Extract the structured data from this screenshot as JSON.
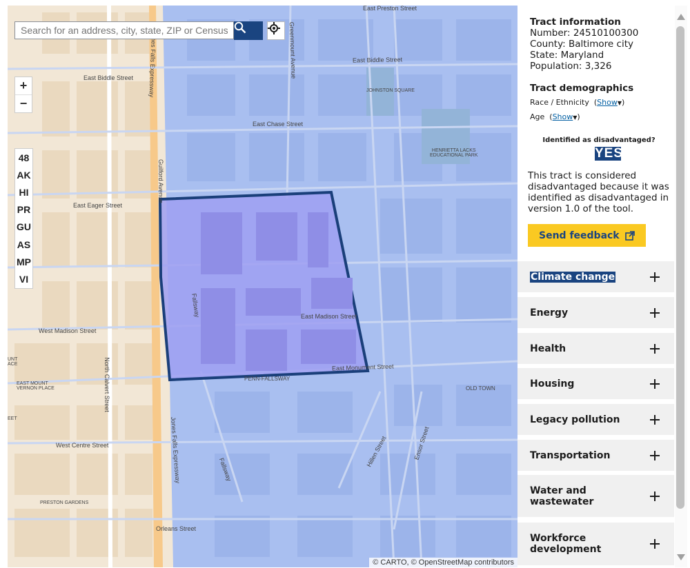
{
  "search": {
    "placeholder": "Search for an address, city, state, ZIP or Census Tract"
  },
  "zoom": {
    "in_label": "+",
    "out_label": "−"
  },
  "territories": [
    "48",
    "AK",
    "HI",
    "PR",
    "GU",
    "AS",
    "MP",
    "VI"
  ],
  "map": {
    "labels": {
      "east_preston": "East Preston Street",
      "east_biddle_top": "East Biddle Street",
      "east_biddle": "East Biddle Street",
      "east_chase": "East Chase Street",
      "east_eager": "East Eager Street",
      "east_madison": "East Madison Street",
      "east_monument": "East Monument Street",
      "west_madison": "West Madison Street",
      "west_centre": "West Centre Street",
      "orleans": "Orleans Street",
      "hillen": "Hillen Street",
      "ensor": "Ensor Street",
      "fallsway": "Fallsway",
      "fallsway2": "Fallsway",
      "guilford": "Guilford Avenue",
      "greenmount": "Greenmount Avenue",
      "n_calvert": "North Calvert Street",
      "jfe_top": "Jones Falls Expressway",
      "jfe_bottom": "Jones Falls Expressway",
      "johnston": "JOHNSTON SQUARE",
      "henrietta": "HENRIETTA LACKS\nEDUCATIONAL PARK",
      "penn_fallsway": "PENN-FALLSWAY",
      "old_town": "OLD TOWN",
      "east_mount_vernon": "EAST MOUNT\nVERNON PLACE",
      "preston_gardens": "PRESTON GARDENS",
      "mount_vernon": "UNT\nACE",
      "tail_street": "EET"
    },
    "attribution": "© CARTO, © OpenStreetMap contributors"
  },
  "panel": {
    "tract_info_heading": "Tract information",
    "number": "Number: 24510100300",
    "county": "County: Baltimore city",
    "state": "State: Maryland",
    "population": "Population: 3,326",
    "demographics_heading": "Tract demographics",
    "race_label": "Race / Ethnicity",
    "age_label": "Age",
    "show_label": "Show",
    "identified_label": "Identified as disadvantaged?",
    "identified_value": "YES",
    "reason": "This tract is considered disadvantaged because it was identified as disadvantaged in version 1.0 of the tool.",
    "feedback_label": "Send feedback",
    "categories": [
      "Climate change",
      "Energy",
      "Health",
      "Housing",
      "Legacy pollution",
      "Transportation",
      "Water and wastewater",
      "Workforce development"
    ]
  },
  "colors": {
    "accent": "#1a4480",
    "feedback": "#fac922",
    "tract_fill": "#9f9ff2",
    "map_overlay": "#a9bff0"
  }
}
